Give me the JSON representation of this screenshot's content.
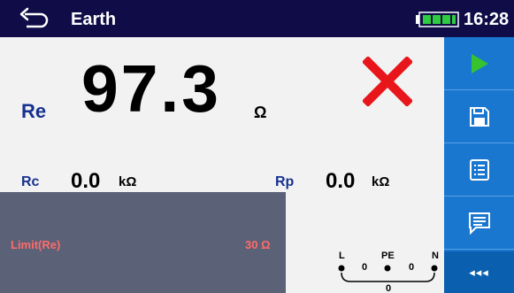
{
  "header": {
    "title": "Earth",
    "time": "16:28",
    "battery_level": 1.0
  },
  "measurement": {
    "main_label": "Re",
    "main_value": "97.3",
    "main_unit": "Ω",
    "status": "fail",
    "rc_label": "Rc",
    "rc_value": "0.0",
    "rc_unit": "kΩ",
    "rp_label": "Rp",
    "rp_value": "0.0",
    "rp_unit": "kΩ"
  },
  "limit": {
    "label": "Limit(Re)",
    "value": "30 Ω"
  },
  "terminals": {
    "l": "L",
    "pe": "PE",
    "n": "N",
    "l_pe": "0",
    "pe_n": "0",
    "l_n": "0"
  },
  "sidebar": {
    "more_label": "◂◂◂"
  },
  "colors": {
    "header_bg": "#0f0c48",
    "sidebar_bg": "#1977d0",
    "label_blue": "#16318f",
    "fail_red": "#e8161b",
    "start_green": "#35c430",
    "limit_bg": "#5b6177",
    "limit_text": "#ff6b6b"
  }
}
